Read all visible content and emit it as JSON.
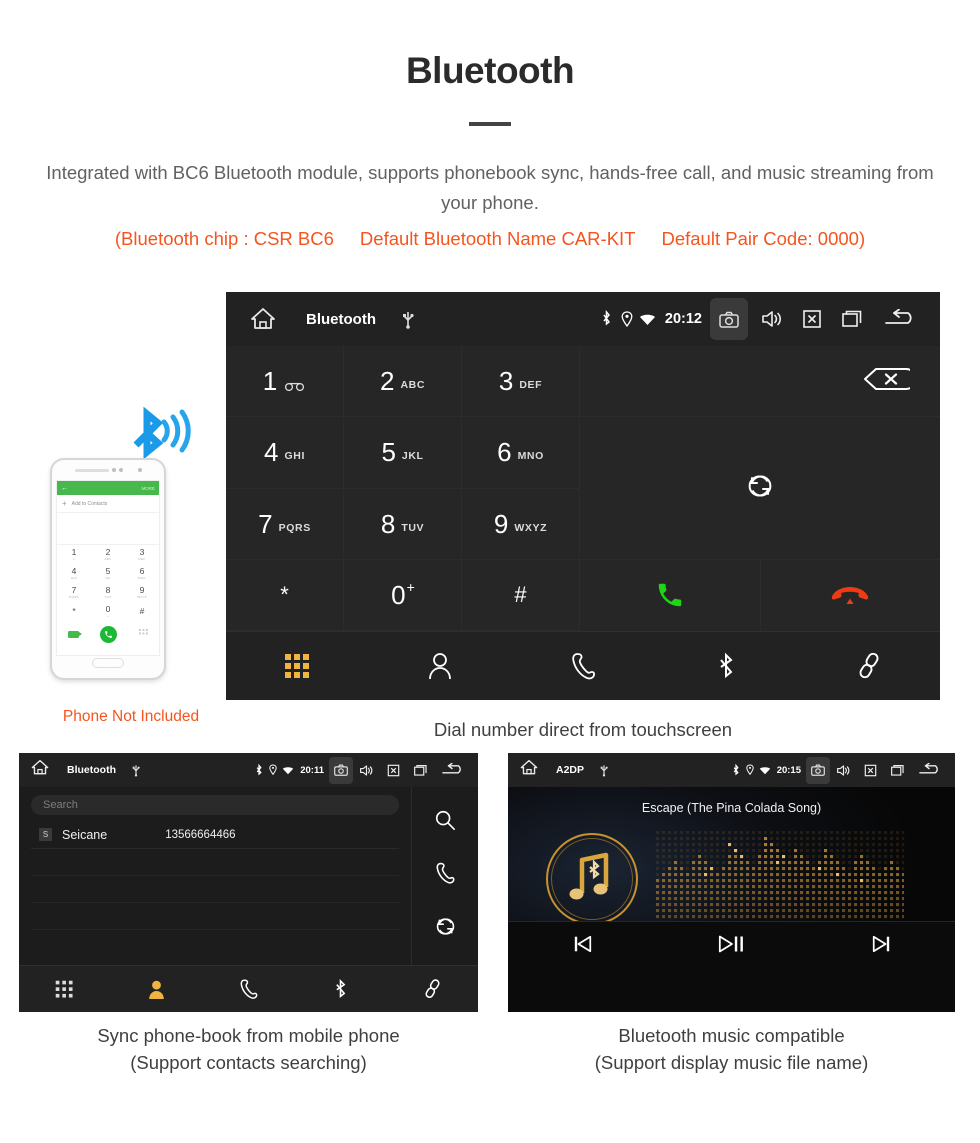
{
  "header": {
    "title": "Bluetooth",
    "description": "Integrated with BC6 Bluetooth module, supports phonebook sync, hands-free call, and music streaming from your phone.",
    "spec_chip": "(Bluetooth chip : CSR BC6",
    "spec_name": "Default Bluetooth Name CAR-KIT",
    "spec_pair": "Default Pair Code: 0000)",
    "accent_color": "#f4551f",
    "text_color": "#616161"
  },
  "phone_illustration": {
    "note": "Phone Not Included",
    "screen": {
      "back_label": "←",
      "more_label": "MORE",
      "add_contacts": "Add to Contacts",
      "plus": "+",
      "keys": [
        {
          "digit": "1",
          "letters": "∞"
        },
        {
          "digit": "2",
          "letters": "ABC"
        },
        {
          "digit": "3",
          "letters": "DEF"
        },
        {
          "digit": "4",
          "letters": "GHI"
        },
        {
          "digit": "5",
          "letters": "JKL"
        },
        {
          "digit": "6",
          "letters": "MNO"
        },
        {
          "digit": "7",
          "letters": "PQRS"
        },
        {
          "digit": "8",
          "letters": "TUV"
        },
        {
          "digit": "9",
          "letters": "WXYZ"
        },
        {
          "digit": "*",
          "letters": ""
        },
        {
          "digit": "0",
          "letters": "+"
        },
        {
          "digit": "#",
          "letters": ""
        }
      ]
    }
  },
  "dialer": {
    "status_bar": {
      "title": "Bluetooth",
      "time": "20:12",
      "icons": [
        "home-icon",
        "usb-icon",
        "bluetooth-icon",
        "location-icon",
        "wifi-icon",
        "camera-icon",
        "volume-icon",
        "close-icon",
        "recents-icon",
        "back-icon"
      ]
    },
    "keys": [
      {
        "digit": "1",
        "letters": "",
        "sub": "voicemail"
      },
      {
        "digit": "2",
        "letters": "ABC"
      },
      {
        "digit": "3",
        "letters": "DEF"
      },
      {
        "digit": "4",
        "letters": "GHI"
      },
      {
        "digit": "5",
        "letters": "JKL"
      },
      {
        "digit": "6",
        "letters": "MNO"
      },
      {
        "digit": "7",
        "letters": "PQRS"
      },
      {
        "digit": "8",
        "letters": "TUV"
      },
      {
        "digit": "9",
        "letters": "WXYZ"
      },
      {
        "digit": "*",
        "letters": ""
      },
      {
        "digit": "0",
        "letters": "+"
      },
      {
        "digit": "#",
        "letters": ""
      }
    ],
    "actions": {
      "backspace": "backspace-icon",
      "sync": "sync-icon",
      "call": "call-icon",
      "hangup": "hangup-icon",
      "call_color": "#1fd317",
      "hangup_color": "#ee3b13"
    },
    "nav_items": [
      {
        "name": "keypad",
        "active": true
      },
      {
        "name": "contacts",
        "active": false
      },
      {
        "name": "call-log",
        "active": false
      },
      {
        "name": "bluetooth",
        "active": false
      },
      {
        "name": "pair-link",
        "active": false
      }
    ],
    "active_color": "#f0b442",
    "caption": "Dial number direct from touchscreen"
  },
  "phonebook": {
    "status_bar": {
      "title": "Bluetooth",
      "time": "20:11"
    },
    "search_placeholder": "Search",
    "contacts": [
      {
        "initial": "S",
        "name": "Seicane",
        "number": "13566664466"
      }
    ],
    "side_actions": [
      "search-icon",
      "call-icon",
      "sync-icon"
    ],
    "nav_items": [
      {
        "name": "keypad",
        "active": false
      },
      {
        "name": "contacts",
        "active": true
      },
      {
        "name": "call-log",
        "active": false
      },
      {
        "name": "bluetooth",
        "active": false
      },
      {
        "name": "pair-link",
        "active": false
      }
    ],
    "caption_line1": "Sync phone-book from mobile phone",
    "caption_line2": "(Support contacts searching)"
  },
  "music": {
    "status_bar": {
      "title": "A2DP",
      "time": "20:15"
    },
    "track_title": "Escape (The Pina Colada Song)",
    "controls": [
      "previous-icon",
      "play-pause-icon",
      "next-icon"
    ],
    "accent_color": "#d79a33",
    "caption_line1": "Bluetooth music compatible",
    "caption_line2": "(Support display music file name)"
  }
}
